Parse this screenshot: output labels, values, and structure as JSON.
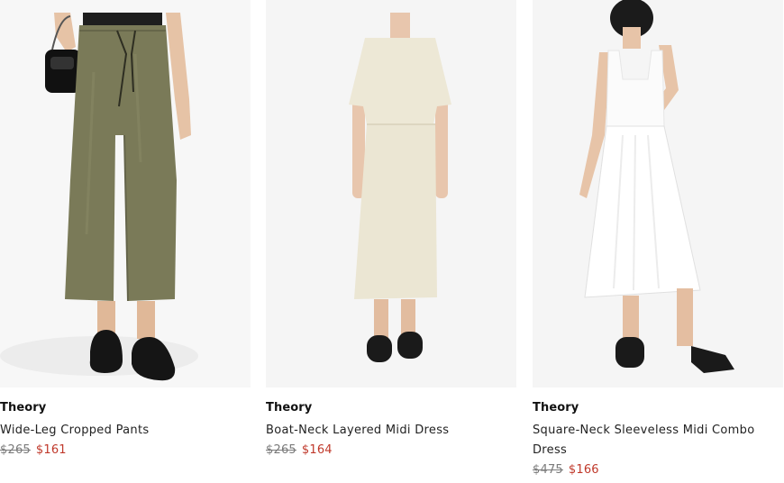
{
  "products": [
    {
      "brand": "Theory",
      "name": "Wide-Leg Cropped Pants",
      "original_price": "$265",
      "sale_price": "$161",
      "image_icon": "product-photo-olive-pants"
    },
    {
      "brand": "Theory",
      "name": "Boat-Neck Layered Midi Dress",
      "original_price": "$265",
      "sale_price": "$164",
      "image_icon": "product-photo-ivory-dress"
    },
    {
      "brand": "Theory",
      "name": "Square-Neck Sleeveless Midi Combo Dress",
      "original_price": "$475",
      "sale_price": "$166",
      "image_icon": "product-photo-white-dress"
    }
  ],
  "colors": {
    "sale": "#c0392b",
    "original": "#7a7a7a",
    "photo_bg": "#f6f6f6"
  }
}
